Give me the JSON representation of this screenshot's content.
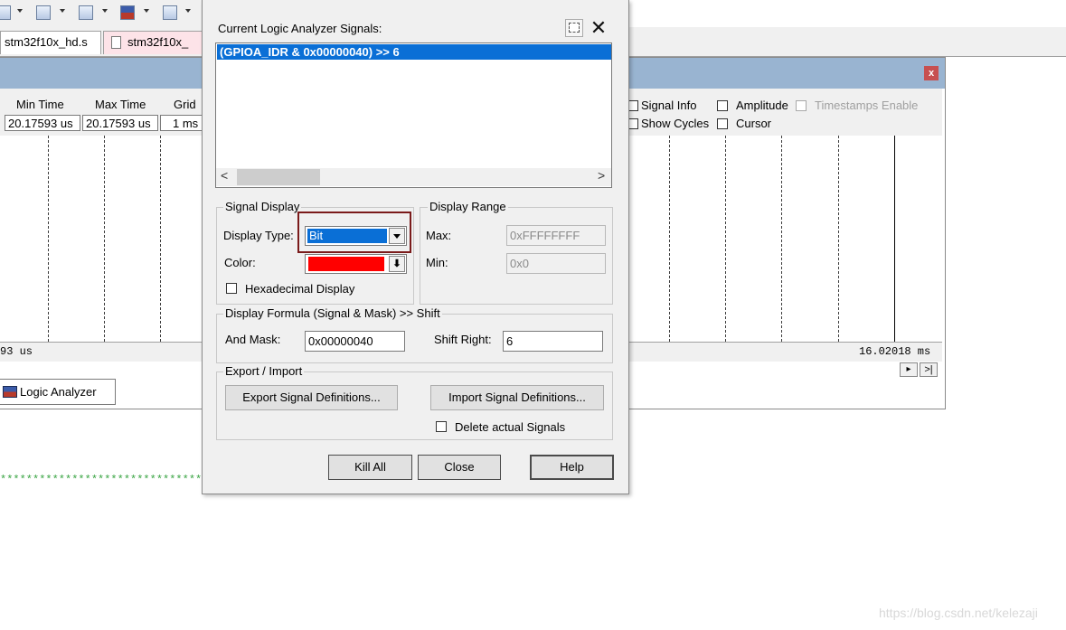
{
  "ide": {
    "toolbar_icons": [
      "window-icon",
      "grid-icon",
      "watch-icon",
      "logic-analyzer-icon",
      "table-icon"
    ],
    "tabs": [
      {
        "label": "stm32f10x_hd.s",
        "active": false
      },
      {
        "label": "stm32f10x_",
        "active": true
      }
    ],
    "close_glyph": "x"
  },
  "logic_analyzer": {
    "headers": {
      "min_time": "Min Time",
      "max_time": "Max Time",
      "grid": "Grid"
    },
    "values": {
      "min_time": "20.17593 us",
      "max_time": "20.17593 us",
      "grid": "1 ms"
    },
    "options": {
      "signal_info": "Signal Info",
      "amplitude": "Amplitude",
      "timestamps_enable": "Timestamps Enable",
      "show_cycles": "Show Cycles",
      "cursor": "Cursor"
    },
    "time_left": "93 us",
    "time_right": "16.02018 ms",
    "scroll_glyphs": {
      "right": "▸",
      "end": ">|"
    },
    "bottom_tab": "Logic Analyzer",
    "stars": "**************************************"
  },
  "dialog": {
    "signals_label": "Current Logic Analyzer Signals:",
    "signals": [
      "(GPIOA_IDR & 0x00000040) >> 6"
    ],
    "delete_glyph": "✕",
    "scroll_glyphs": {
      "left": "<",
      "right": ">"
    },
    "signal_display": {
      "legend": "Signal Display",
      "display_type_label": "Display Type:",
      "display_type_value": "Bit",
      "color_label": "Color:",
      "color_value": "#ff0000",
      "hex_label": "Hexadecimal Display"
    },
    "display_range": {
      "legend": "Display Range",
      "max_label": "Max:",
      "max_value": "0xFFFFFFFF",
      "min_label": "Min:",
      "min_value": "0x0"
    },
    "formula": {
      "legend": "Display Formula (Signal & Mask) >> Shift",
      "and_mask_label": "And Mask:",
      "and_mask_value": "0x00000040",
      "shift_right_label": "Shift Right:",
      "shift_right_value": "6"
    },
    "export_import": {
      "legend": "Export / Import",
      "export_button": "Export Signal Definitions...",
      "import_button": "Import Signal Definitions...",
      "delete_actual_label": "Delete actual Signals"
    },
    "buttons": {
      "kill_all": "Kill All",
      "close": "Close",
      "help": "Help"
    }
  },
  "highlight_color": "#7a1a1a",
  "selection_color": "#0a6fd6",
  "watermark": "https://blog.csdn.net/kelezaji"
}
